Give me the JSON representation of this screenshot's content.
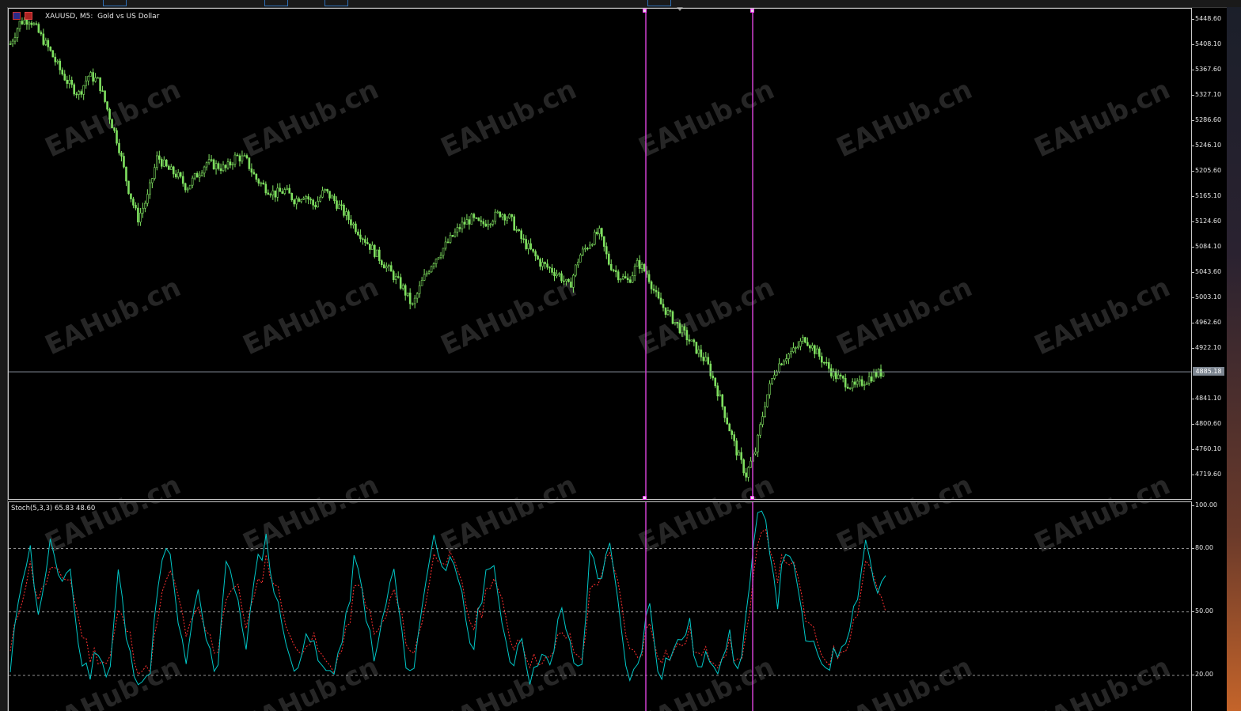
{
  "chart_title": {
    "symbol": "XAUUSD, M5:",
    "description": "Gold vs US Dollar"
  },
  "price_axis": {
    "labels": [
      "5448.60",
      "5408.10",
      "5367.60",
      "5327.10",
      "5286.60",
      "5246.10",
      "5205.60",
      "5165.10",
      "5124.60",
      "5084.10",
      "5043.60",
      "5003.10",
      "4962.60",
      "4922.10",
      "4841.10",
      "4800.60",
      "4760.10",
      "4719.60"
    ],
    "current_price": "4885.18"
  },
  "stoch": {
    "title": "Stoch(5,3,3) 65.83 48.60",
    "axis_labels": [
      "100.00",
      "80.00",
      "50.00",
      "20.00"
    ],
    "levels": [
      80,
      50,
      20
    ],
    "main_color": "#00c8c8",
    "signal_color": "#ff3030"
  },
  "watermark": {
    "text": "EAHub.cn"
  },
  "colors": {
    "background": "#000000",
    "candles": "#7fe060",
    "vertical_lines": "#d040d0",
    "grid_levels": "#bfbfbf"
  },
  "chart_data": {
    "type": "line",
    "price_range": [
      4700,
      5460
    ],
    "close_path": [
      5410,
      5445,
      5450,
      5425,
      5400,
      5370,
      5345,
      5330,
      5360,
      5350,
      5300,
      5250,
      5180,
      5130,
      5165,
      5230,
      5210,
      5200,
      5180,
      5200,
      5220,
      5215,
      5210,
      5230,
      5225,
      5195,
      5180,
      5170,
      5175,
      5160,
      5170,
      5150,
      5175,
      5160,
      5140,
      5120,
      5100,
      5080,
      5060,
      5040,
      5020,
      4990,
      5030,
      5060,
      5080,
      5100,
      5120,
      5130,
      5120,
      5130,
      5140,
      5130,
      5100,
      5080,
      5060,
      5050,
      5040,
      5020,
      5070,
      5090,
      5110,
      5060,
      5040,
      5030,
      5060,
      5040,
      5000,
      4980,
      4960,
      4940,
      4920,
      4900,
      4860,
      4810,
      4760,
      4720,
      4760,
      4840,
      4890,
      4910,
      4920,
      4940,
      4920,
      4900,
      4880,
      4870,
      4860,
      4870,
      4880,
      4885
    ],
    "stoch_main": [
      20,
      65,
      80,
      45,
      85,
      60,
      75,
      30,
      20,
      35,
      15,
      70,
      30,
      20,
      15,
      60,
      85,
      45,
      25,
      60,
      35,
      20,
      80,
      55,
      35,
      70,
      85,
      55,
      40,
      15,
      45,
      30,
      20,
      25,
      40,
      75,
      55,
      25,
      50,
      70,
      30,
      20,
      60,
      85,
      75,
      70,
      55,
      30,
      60,
      80,
      40,
      25,
      40,
      15,
      35,
      20,
      55,
      30,
      20,
      80,
      65,
      80,
      45,
      15,
      30,
      55,
      20,
      30,
      35,
      45,
      20,
      30,
      25,
      40,
      20,
      55,
      95,
      90,
      55,
      85,
      60,
      35,
      30,
      25,
      30,
      40,
      55,
      85,
      60,
      65
    ],
    "stoch_signal": [
      30,
      55,
      72,
      55,
      70,
      65,
      68,
      45,
      30,
      30,
      25,
      50,
      40,
      25,
      20,
      45,
      70,
      58,
      38,
      50,
      40,
      30,
      60,
      62,
      45,
      58,
      75,
      62,
      48,
      28,
      38,
      35,
      25,
      25,
      35,
      60,
      60,
      38,
      45,
      60,
      42,
      28,
      50,
      75,
      78,
      72,
      60,
      42,
      52,
      70,
      52,
      35,
      38,
      25,
      30,
      25,
      42,
      35,
      25,
      60,
      68,
      75,
      58,
      30,
      30,
      45,
      30,
      30,
      33,
      40,
      28,
      30,
      28,
      35,
      25,
      42,
      80,
      88,
      68,
      78,
      65,
      45,
      35,
      28,
      30,
      36,
      48,
      75,
      66,
      48
    ]
  }
}
